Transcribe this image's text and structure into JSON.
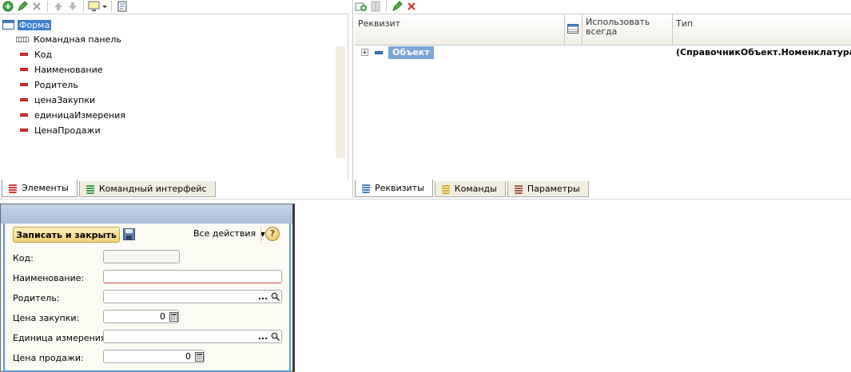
{
  "left": {
    "tree": {
      "root": "Форма",
      "items": [
        "Командная панель",
        "Код",
        "Наименование",
        "Родитель",
        "ценаЗакупки",
        "единицаИзмерения",
        "ЦенаПродажи"
      ]
    },
    "tabs": [
      "Элементы",
      "Командный интерфейс"
    ]
  },
  "right": {
    "columns": [
      "Реквизит",
      "Использовать всегда",
      "Тип"
    ],
    "rows": [
      {
        "name": "Объект",
        "type": "(СправочникОбъект.Номенклатура)"
      }
    ],
    "tabs": [
      "Реквизиты",
      "Команды",
      "Параметры"
    ]
  },
  "form": {
    "save_close_label": "Записать и закрыть",
    "all_actions_label": "Все действия",
    "help_label": "?",
    "ellipsis": "...",
    "fields": {
      "kod": "Код:",
      "naim": "Наименование:",
      "roditel": "Родитель:",
      "cena_zak": "Цена закупки:",
      "edin": "Единица измерения:",
      "cena_prod": "Цена продажи:"
    },
    "values": {
      "cena_zak": "0",
      "cena_prod": "0"
    }
  },
  "colors": {
    "accent_blue": "#3b7fd1",
    "selection": "#7aa6d8",
    "button_yellow": "#f3cf72",
    "form_frame": "#5a98d6"
  }
}
